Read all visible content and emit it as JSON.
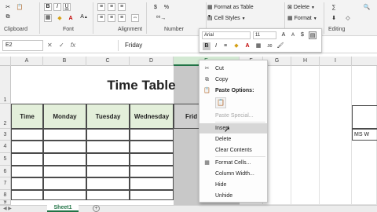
{
  "ribbon": {
    "groups": [
      "Clipboard",
      "Font",
      "Alignment",
      "Number",
      "Editing"
    ],
    "format_as_table": "Format as Table",
    "cell_styles": "Cell Styles",
    "delete": "Delete",
    "format": "Format",
    "currency": "$",
    "percent": "%"
  },
  "formula_bar": {
    "name_box": "E2",
    "fx": "fx",
    "value": "Friday"
  },
  "columns": [
    "A",
    "B",
    "C",
    "D",
    "E",
    "F",
    "G",
    "H",
    "I"
  ],
  "rows": [
    "1",
    "2",
    "3",
    "4",
    "5",
    "6",
    "7",
    "8",
    "9"
  ],
  "sheet": {
    "title": "Time Table",
    "headers": [
      "Time",
      "Monday",
      "Tuesday",
      "Wednesday",
      "Frid"
    ],
    "side_note": "MS W"
  },
  "tabs": {
    "active": "Sheet1",
    "add": "+"
  },
  "mini_toolbar": {
    "font": "Arial",
    "size": "11",
    "bold": "B",
    "italic": "I"
  },
  "context_menu": {
    "cut": "Cut",
    "copy": "Copy",
    "paste_options": "Paste Options:",
    "paste_special": "Paste Special...",
    "insert": "Insert",
    "delete": "Delete",
    "clear_contents": "Clear Contents",
    "format_cells": "Format Cells...",
    "column_width": "Column Width...",
    "hide": "Hide",
    "unhide": "Unhide"
  },
  "colors": {
    "accent": "#217346",
    "header_fill": "#e3efda",
    "selected_column": "#c8c8c8",
    "menu_highlight": "#d7d7d7"
  }
}
